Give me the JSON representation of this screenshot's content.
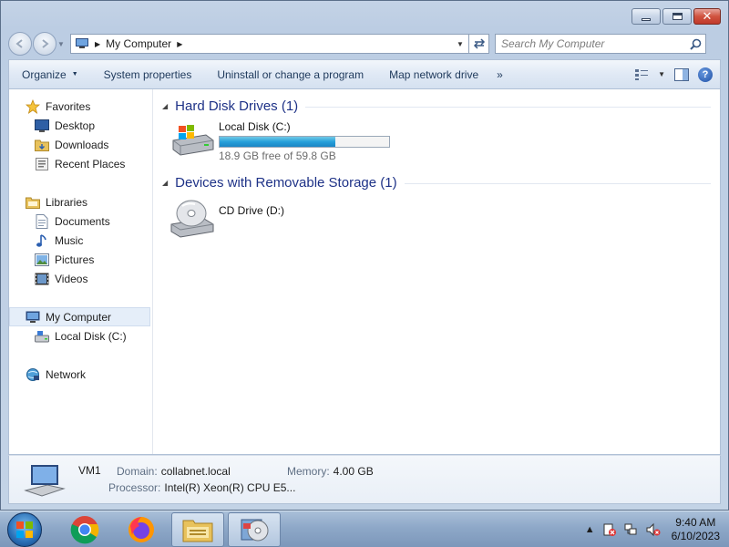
{
  "window": {
    "close_symbol": "✕"
  },
  "navigation": {
    "back_icon": "back-arrow-icon",
    "forward_icon": "forward-arrow-icon",
    "address": "My Computer",
    "search_placeholder": "Search My Computer"
  },
  "commands": {
    "organize": "Organize",
    "system_properties": "System properties",
    "uninstall": "Uninstall or change a program",
    "map_drive": "Map network drive",
    "more": "»",
    "help": "?"
  },
  "sidebar": {
    "favorites": {
      "label": "Favorites",
      "items": [
        "Desktop",
        "Downloads",
        "Recent Places"
      ]
    },
    "libraries": {
      "label": "Libraries",
      "items": [
        "Documents",
        "Music",
        "Pictures",
        "Videos"
      ]
    },
    "computer": {
      "label": "My Computer",
      "items": [
        "Local Disk (C:)"
      ]
    },
    "network": {
      "label": "Network"
    }
  },
  "groups": {
    "hdd": {
      "title": "Hard Disk Drives (1)"
    },
    "removable": {
      "title": "Devices with Removable Storage (1)"
    }
  },
  "drives": {
    "c": {
      "name": "Local Disk (C:)",
      "free_text": "18.9 GB free of 59.8 GB",
      "used_fraction": 0.684
    },
    "d": {
      "name": "CD Drive (D:)"
    }
  },
  "details": {
    "name": "VM1",
    "domain_label": "Domain:",
    "domain_value": "collabnet.local",
    "memory_label": "Memory:",
    "memory_value": "4.00 GB",
    "processor_label": "Processor:",
    "processor_value": "Intel(R) Xeon(R) CPU E5..."
  },
  "taskbar": {
    "tray_arrow": "▲",
    "time": "9:40 AM",
    "date": "6/10/2023"
  },
  "colors": {
    "group_header": "#1e3287",
    "bar_fill": "#26a0da",
    "command_text": "#1e395b"
  }
}
